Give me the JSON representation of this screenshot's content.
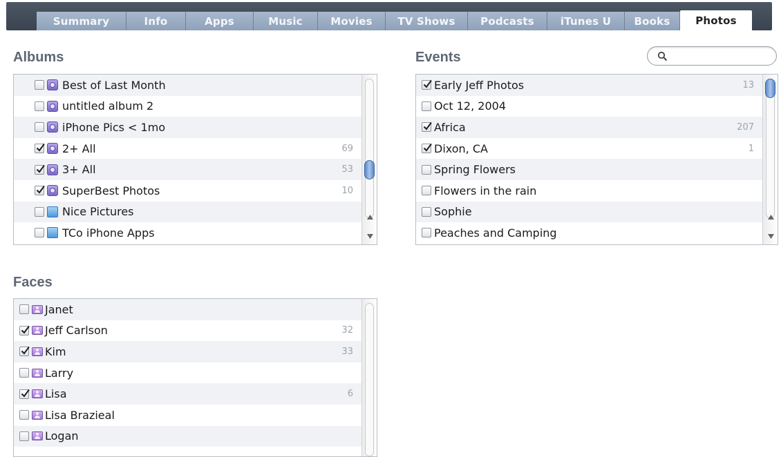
{
  "tabs": [
    {
      "label": "Summary"
    },
    {
      "label": "Info"
    },
    {
      "label": "Apps"
    },
    {
      "label": "Music"
    },
    {
      "label": "Movies"
    },
    {
      "label": "TV Shows"
    },
    {
      "label": "Podcasts"
    },
    {
      "label": "iTunes U"
    },
    {
      "label": "Books"
    },
    {
      "label": "Photos"
    }
  ],
  "active_tab": "Photos",
  "albums": {
    "title": "Albums",
    "items": [
      {
        "label": "Best of Last Month",
        "checked": false,
        "icon": "smart-album-icon",
        "count": ""
      },
      {
        "label": "untitled album 2",
        "checked": false,
        "icon": "smart-album-icon",
        "count": ""
      },
      {
        "label": "iPhone Pics < 1mo",
        "checked": false,
        "icon": "smart-album-icon",
        "count": ""
      },
      {
        "label": "2+ All",
        "checked": true,
        "icon": "smart-album-icon",
        "count": "69"
      },
      {
        "label": "3+ All",
        "checked": true,
        "icon": "smart-album-icon",
        "count": "53"
      },
      {
        "label": "SuperBest Photos",
        "checked": true,
        "icon": "smart-album-icon",
        "count": "10"
      },
      {
        "label": "Nice Pictures",
        "checked": false,
        "icon": "album-icon",
        "count": ""
      },
      {
        "label": "TCo iPhone Apps",
        "checked": false,
        "icon": "album-icon",
        "count": ""
      }
    ]
  },
  "events": {
    "title": "Events",
    "search_placeholder": "",
    "items": [
      {
        "label": "Early Jeff Photos",
        "checked": true,
        "count": "13"
      },
      {
        "label": "Oct 12, 2004",
        "checked": false,
        "count": ""
      },
      {
        "label": "Africa",
        "checked": true,
        "count": "207"
      },
      {
        "label": "Dixon, CA",
        "checked": true,
        "count": "1"
      },
      {
        "label": "Spring Flowers",
        "checked": false,
        "count": ""
      },
      {
        "label": "Flowers in the rain",
        "checked": false,
        "count": ""
      },
      {
        "label": "Sophie",
        "checked": false,
        "count": ""
      },
      {
        "label": "Peaches and Camping",
        "checked": false,
        "count": ""
      }
    ]
  },
  "faces": {
    "title": "Faces",
    "items": [
      {
        "label": "Janet",
        "checked": false,
        "count": ""
      },
      {
        "label": "Jeff Carlson",
        "checked": true,
        "count": "32"
      },
      {
        "label": "Kim",
        "checked": true,
        "count": "33"
      },
      {
        "label": "Larry",
        "checked": false,
        "count": ""
      },
      {
        "label": "Lisa",
        "checked": true,
        "count": "6"
      },
      {
        "label": "Lisa Brazieal",
        "checked": false,
        "count": ""
      },
      {
        "label": "Logan",
        "checked": false,
        "count": ""
      }
    ]
  },
  "colors": {
    "tab_bar": "#3e4754",
    "tab": "#98aac1",
    "section_title": "#5e6775",
    "scroll_thumb": "#5a87c8"
  }
}
